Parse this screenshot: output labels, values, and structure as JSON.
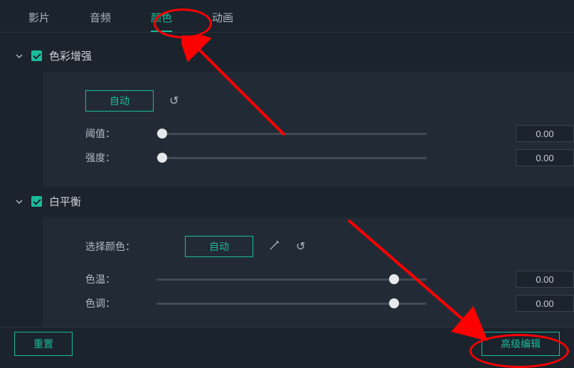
{
  "tabs": {
    "movie": "影片",
    "audio": "音频",
    "color": "颜色",
    "animation": "动画"
  },
  "sections": {
    "colorEnhance": {
      "title": "色彩增强"
    },
    "whiteBalance": {
      "title": "白平衡"
    }
  },
  "labels": {
    "threshold": "阈值：",
    "strength": "强度：",
    "pickColor": "选择颜色：",
    "temperature": "色温：",
    "tint": "色调："
  },
  "buttons": {
    "auto": "自动",
    "reset": "重置",
    "advancedEdit": "高级编辑"
  },
  "values": {
    "threshold": "0.00",
    "strength": "0.00",
    "temperature": "0.00",
    "tint": "0.00"
  }
}
